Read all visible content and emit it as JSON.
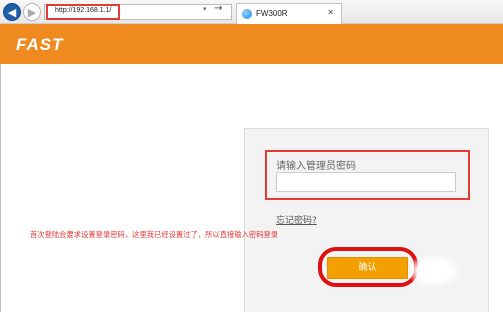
{
  "browser": {
    "back_icon": "back-arrow-icon",
    "forward_icon": "forward-arrow-icon",
    "url": "http://192.168.1.1/",
    "tab_title": "FW300R",
    "tab_icon": "ie-favicon-icon",
    "go_icon": "go-arrow-icon",
    "close_icon": "close-icon"
  },
  "header": {
    "logo": "FAST",
    "background_color": "#ee8a1f"
  },
  "login": {
    "password_label": "请输入管理员密码",
    "password_value": "",
    "forgot_link": "忘记密码?",
    "confirm_label": "确认"
  },
  "annotation": {
    "text": "首次登陆会要求设置登录密码，这里我已经设置过了，所以直接输入密码登录",
    "color": "#e53935"
  }
}
